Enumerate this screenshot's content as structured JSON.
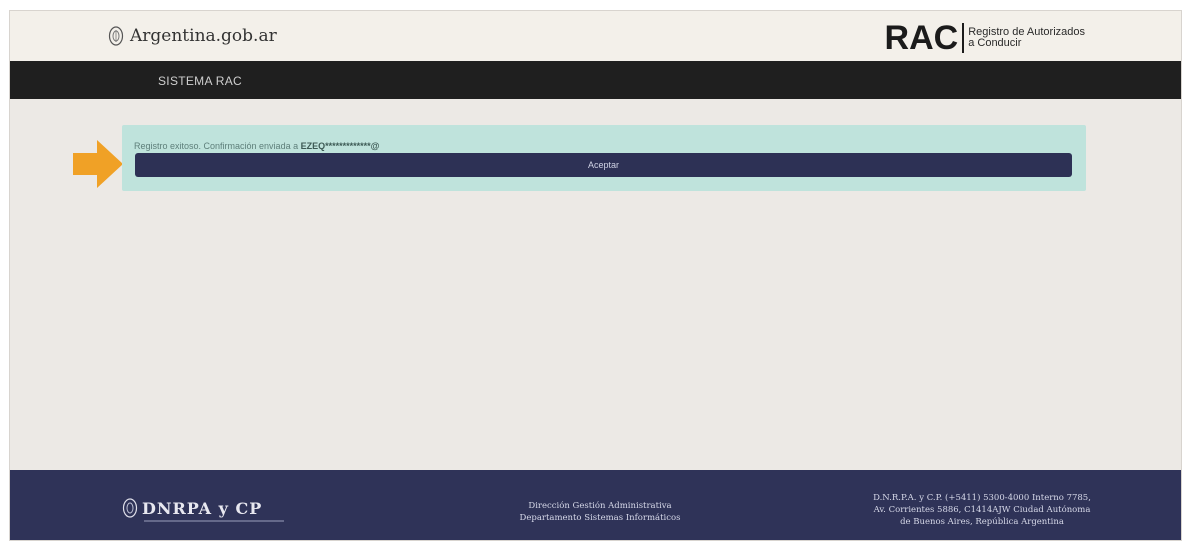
{
  "header": {
    "gob_logo_text": "Argentina.gob.ar",
    "rac_abbr": "RAC",
    "rac_subtitle_line1": "Registro de Autorizados",
    "rac_subtitle_line2": "a Conducir"
  },
  "navbar": {
    "title": "SISTEMA RAC"
  },
  "alert": {
    "message_prefix": "Registro exitoso. Confirmación enviada a ",
    "masked_email": "EZEQ*************@",
    "accept_label": "Aceptar",
    "bg_color": "#bfe3dc",
    "button_color": "#2d3155"
  },
  "annotation": {
    "arrow_icon": "arrow-right-icon",
    "arrow_color": "#f0a126"
  },
  "footer": {
    "logo_text": "DNRPA y CP",
    "center_line1": "Dirección Gestión Administrativa",
    "center_line2": "Departamento Sistemas Informáticos",
    "right_line1": "D.N.R.P.A. y C.P. (+5411) 5300-4000 Interno 7785,",
    "right_line2": "Av. Corrientes 5886, C1414AJW Ciudad Autónoma",
    "right_line3": "de Buenos Aires, República Argentina",
    "bg_color": "#2f3358"
  }
}
